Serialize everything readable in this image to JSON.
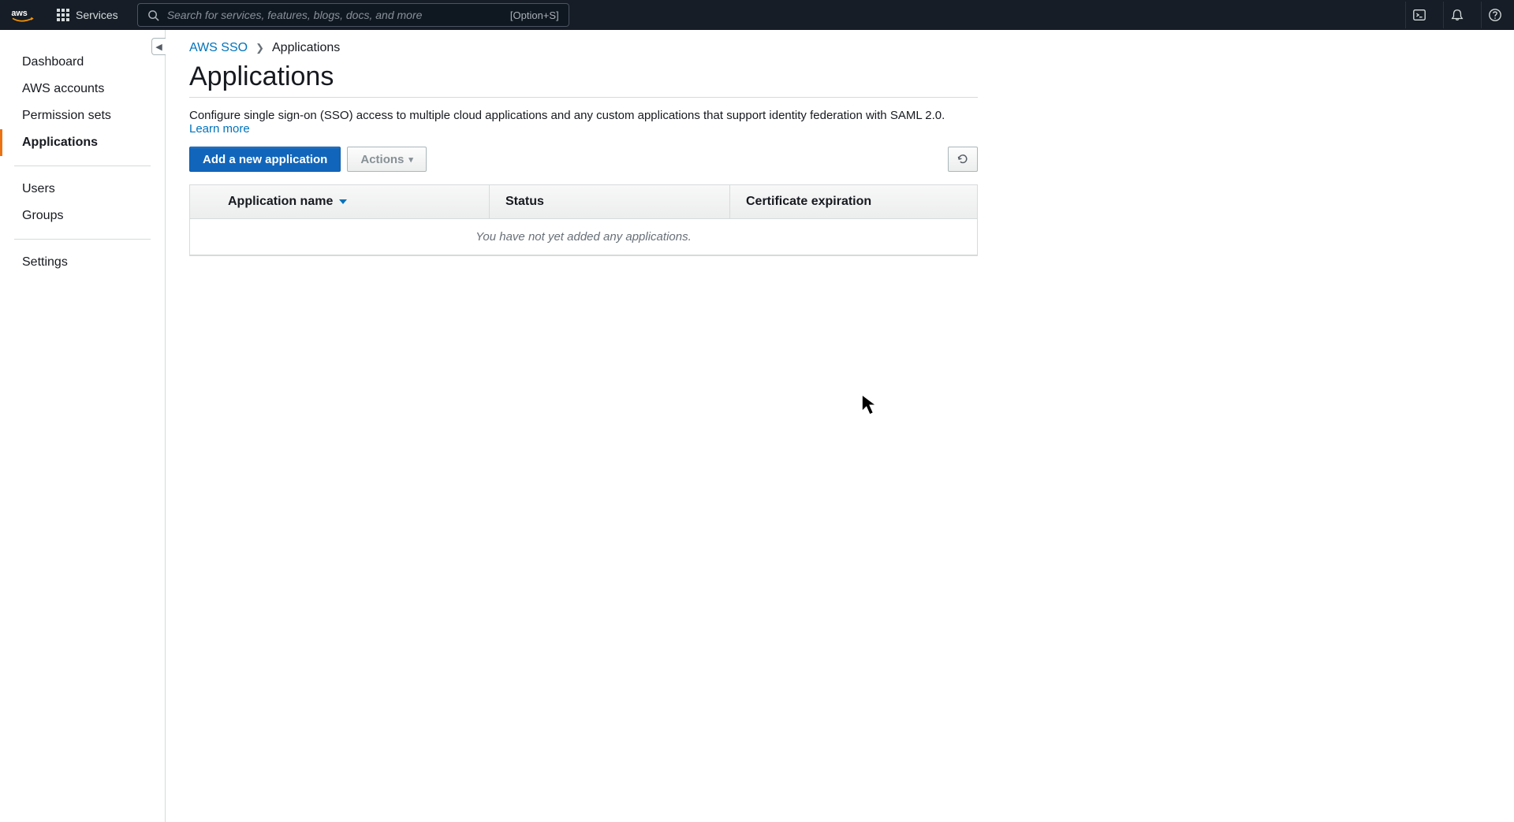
{
  "topnav": {
    "services_label": "Services",
    "search_placeholder": "Search for services, features, blogs, docs, and more",
    "search_shortcut": "[Option+S]"
  },
  "sidebar": {
    "items": [
      {
        "label": "Dashboard"
      },
      {
        "label": "AWS accounts"
      },
      {
        "label": "Permission sets"
      },
      {
        "label": "Applications"
      },
      {
        "label": "Users"
      },
      {
        "label": "Groups"
      },
      {
        "label": "Settings"
      }
    ]
  },
  "breadcrumbs": {
    "root": "AWS SSO",
    "current": "Applications"
  },
  "page": {
    "title": "Applications",
    "description": "Configure single sign-on (SSO) access to multiple cloud applications and any custom applications that support identity federation with SAML 2.0. ",
    "learn_more": "Learn more"
  },
  "actions": {
    "add_label": "Add a new application",
    "actions_label": "Actions"
  },
  "table": {
    "columns": {
      "name": "Application name",
      "status": "Status",
      "expiration": "Certificate expiration"
    },
    "empty_message": "You have not yet added any applications."
  }
}
